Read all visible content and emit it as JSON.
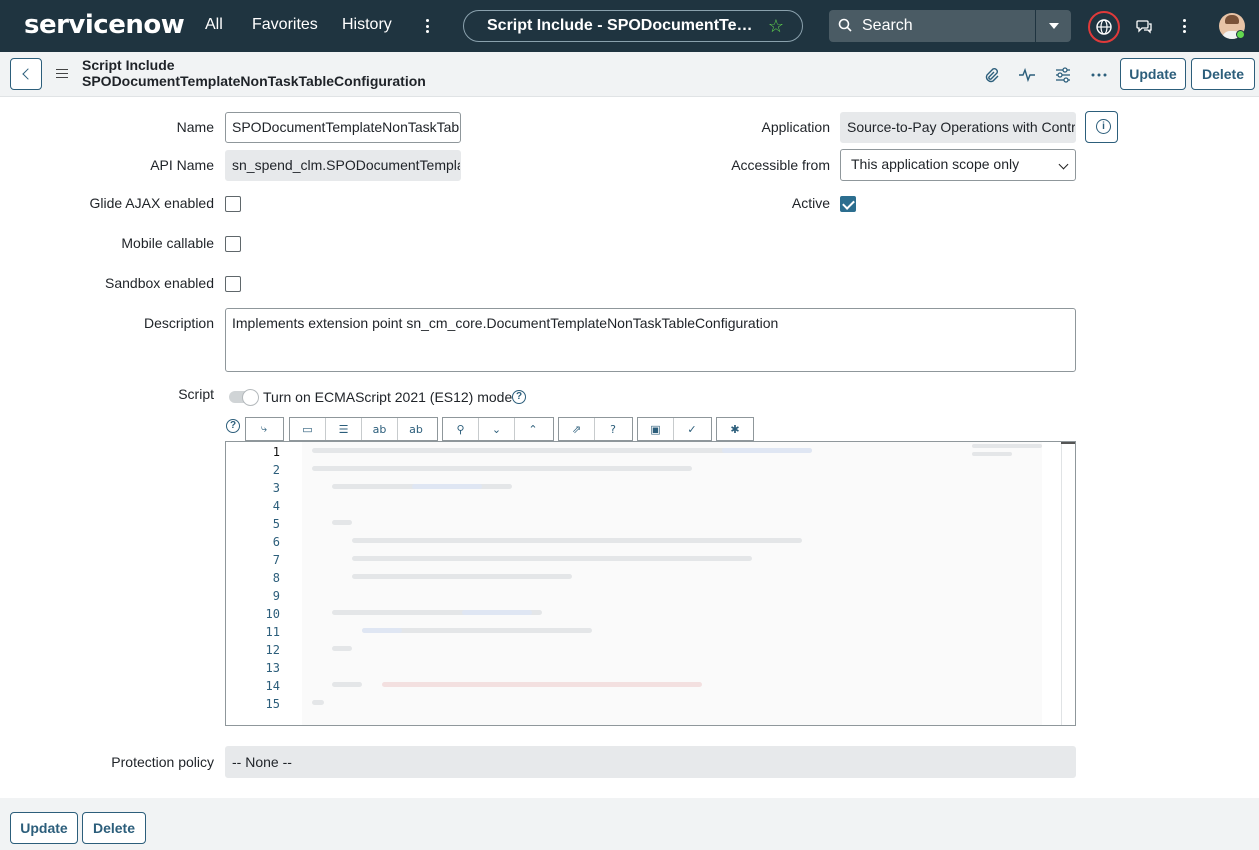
{
  "nav": {
    "logo": "servicenow",
    "links": [
      "All",
      "Favorites",
      "History"
    ],
    "scope_title": "Script Include - SPODocumentTemplateNonTaskTableConfiguration",
    "search_placeholder": "Search"
  },
  "header": {
    "type": "Script Include",
    "name": "SPODocumentTemplateNonTaskTableConfiguration",
    "update_label": "Update",
    "delete_label": "Delete"
  },
  "form": {
    "name_label": "Name",
    "name_value": "SPODocumentTemplateNonTaskTableConfiguration",
    "api_label": "API Name",
    "api_value": "sn_spend_clm.SPODocumentTemplateNonTaskTableConfiguration",
    "application_label": "Application",
    "application_value": "Source-to-Pay Operations with Contract Management",
    "accessible_label": "Accessible from",
    "accessible_value": "This application scope only",
    "glide_label": "Glide AJAX enabled",
    "glide_checked": false,
    "active_label": "Active",
    "active_checked": true,
    "mobile_label": "Mobile callable",
    "mobile_checked": false,
    "sandbox_label": "Sandbox enabled",
    "sandbox_checked": false,
    "description_label": "Description",
    "description_value": "Implements extension point sn_cm_core.DocumentTemplateNonTaskTableConfiguration",
    "script_label": "Script",
    "es12_label": "Turn on ECMAScript 2021 (ES12) mode",
    "protection_label": "Protection policy",
    "protection_value": "-- None --"
  },
  "editor": {
    "line_numbers": [
      "1",
      "2",
      "3",
      "4",
      "5",
      "6",
      "7",
      "8",
      "9",
      "10",
      "11",
      "12",
      "13",
      "14",
      "15"
    ],
    "toolbar": [
      "format-code",
      "toggle-comment",
      "insert-template",
      "replace",
      "replace-all",
      "search",
      "find-next",
      "find-previous",
      "fullscreen",
      "help",
      "save",
      "check-syntax",
      "debug"
    ]
  },
  "footer": {
    "update_label": "Update",
    "delete_label": "Delete"
  },
  "colors": {
    "nav_bg": "#1f3440",
    "accent": "#2c5e7b",
    "status_green": "#62d84e",
    "focus_red": "#e03a3a"
  }
}
